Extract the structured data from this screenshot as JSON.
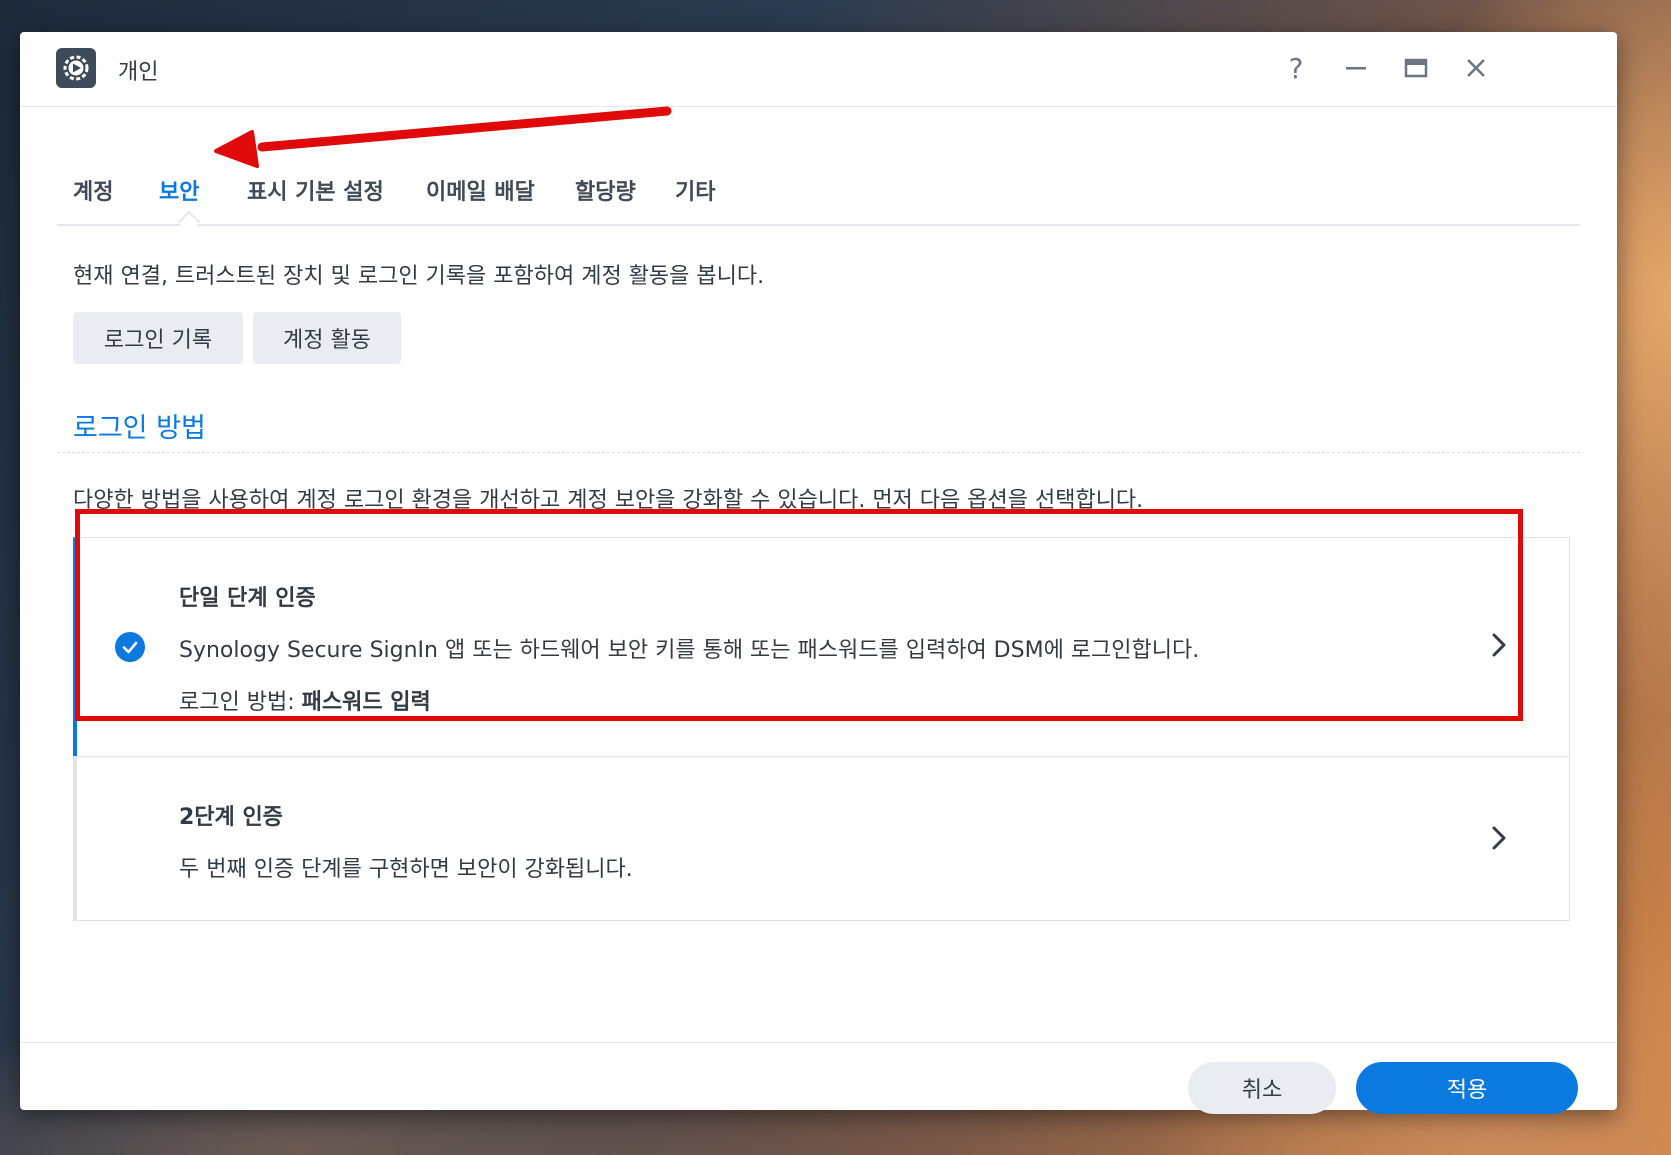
{
  "window": {
    "title": "개인",
    "help_icon": "question-icon",
    "minimize_icon": "minimize-icon",
    "maximize_icon": "maximize-icon",
    "close_icon": "close-icon"
  },
  "tabs": [
    {
      "label": "계정",
      "active": false
    },
    {
      "label": "보안",
      "active": true
    },
    {
      "label": "표시 기본 설정",
      "active": false
    },
    {
      "label": "이메일 배달",
      "active": false
    },
    {
      "label": "할당량",
      "active": false
    },
    {
      "label": "기타",
      "active": false
    }
  ],
  "security": {
    "activity_description": "현재 연결, 트러스트된 장치 및 로그인 기록을 포함하여 계정 활동을 봅니다.",
    "buttons": {
      "login_history": "로그인 기록",
      "account_activity": "계정 활동"
    },
    "login_method_title": "로그인 방법",
    "login_method_description": "다양한 방법을 사용하여 계정 로그인 환경을 개선하고 계정 보안을 강화할 수 있습니다. 먼저 다음 옵션을 선택합니다.",
    "options": [
      {
        "title": "단일 단계 인증",
        "description": "Synology Secure SignIn 앱 또는 하드웨어 보안 키를 통해 또는 패스워드를 입력하여 DSM에 로그인합니다.",
        "method_label": "로그인 방법:",
        "method_value": "패스워드 입력",
        "selected": true
      },
      {
        "title": "2단계 인증",
        "description": "두 번째 인증 단계를 구현하면 보안이 강화됩니다.",
        "selected": false
      }
    ]
  },
  "footer": {
    "cancel_label": "취소",
    "apply_label": "적용"
  },
  "colors": {
    "accent": "#0a7ae0",
    "annotation_red": "#e00a0a"
  }
}
